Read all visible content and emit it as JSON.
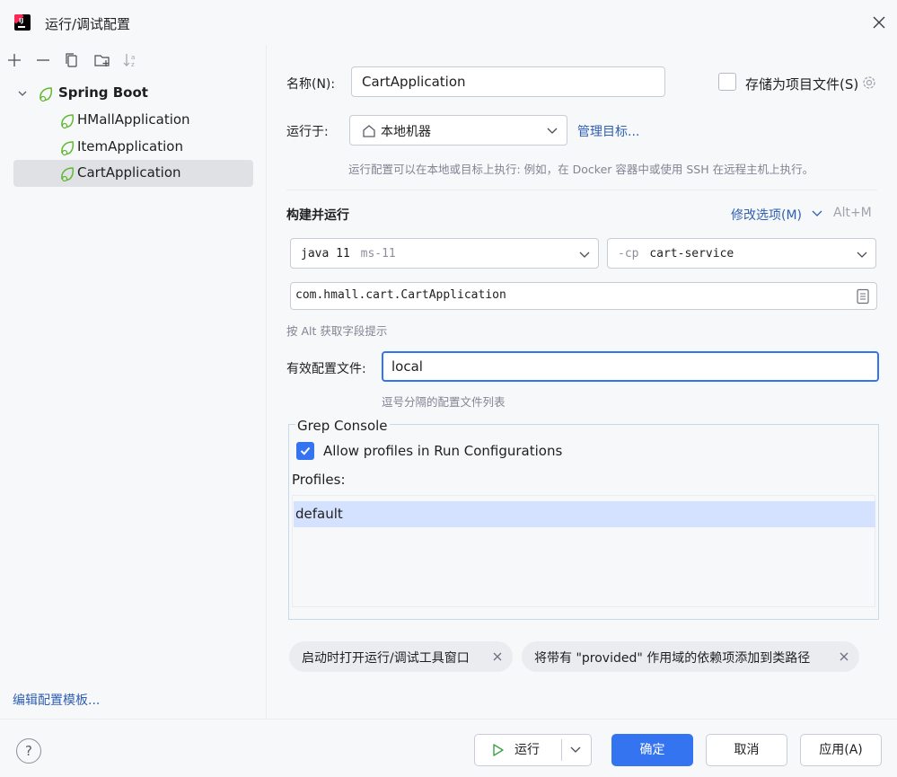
{
  "window": {
    "title": "运行/调试配置",
    "logo_text": "IJ"
  },
  "toolbar": {
    "icons": [
      "add-icon",
      "remove-icon",
      "copy-icon",
      "new-folder-icon",
      "sort-icon"
    ]
  },
  "tree": {
    "root": {
      "label": "Spring Boot",
      "expanded": true
    },
    "items": [
      {
        "label": "HMallApplication",
        "selected": false
      },
      {
        "label": "ItemApplication",
        "selected": false
      },
      {
        "label": "CartApplication",
        "selected": true
      }
    ],
    "edit_templates_link": "编辑配置模板..."
  },
  "form": {
    "name_label": "名称(N):",
    "name_value": "CartApplication",
    "store_as_file_label": "存储为项目文件(S)",
    "store_as_file_checked": false,
    "run_on_label": "运行于:",
    "run_on_value": "本地机器",
    "manage_targets_link": "管理目标...",
    "run_on_hint": "运行配置可以在本地或目标上执行: 例如，在 Docker 容器中或使用 SSH 在远程主机上执行。",
    "build_run_heading": "构建并运行",
    "modify_options_link": "修改选项(M)",
    "modify_options_shortcut": "Alt+M",
    "jdk_main": "java 11",
    "jdk_sub": "ms-11",
    "classpath_flag": "-cp",
    "classpath_value": "cart-service",
    "main_class_value": "com.hmall.cart.CartApplication",
    "alt_hint": "按 Alt 获取字段提示",
    "active_profiles_label": "有效配置文件:",
    "active_profiles_value": "local",
    "active_profiles_hint": "逗号分隔的配置文件列表"
  },
  "grep_console": {
    "title": "Grep Console",
    "allow_profiles_label": "Allow profiles in Run Configurations",
    "allow_profiles_checked": true,
    "profiles_label": "Profiles:",
    "profiles": [
      "default"
    ]
  },
  "chips": [
    {
      "label": "启动时打开运行/调试工具窗口"
    },
    {
      "label": "将带有 \"provided\" 作用域的依赖项添加到类路径"
    }
  ],
  "footer": {
    "help_label": "?",
    "run_label": "运行",
    "ok_label": "确定",
    "cancel_label": "取消",
    "apply_label": "应用(A)"
  },
  "colors": {
    "accent": "#3574f0",
    "link": "#2f5fb4",
    "spring_green": "#5fb832",
    "selection": "#dfe1e5",
    "profile_selection": "#d4e2ff"
  }
}
